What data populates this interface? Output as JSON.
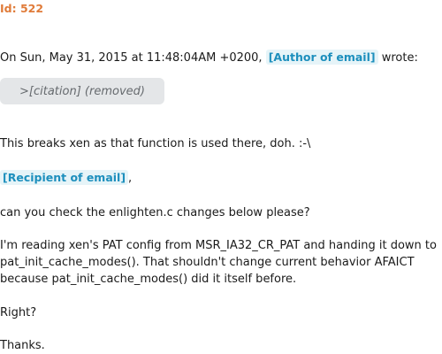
{
  "header": {
    "id_label": "Id: 522"
  },
  "email": {
    "attribution_prefix": "On Sun, May 31, 2015 at 11:48:04AM +0200, ",
    "author_tag": "[Author of email]",
    "attribution_suffix": " wrote:",
    "citation": ">[citation] (removed)",
    "line1": "This breaks xen as that function is used there, doh. :-\\",
    "recipient_tag": "[Recipient of email]",
    "recipient_suffix": ",",
    "line2": "can you check the enlighten.c changes below please?",
    "para1": "I'm reading xen's PAT config from MSR_IA32_CR_PAT and handing it down to",
    "para2": "pat_init_cache_modes(). That shouldn't change current behavior AFAICT",
    "para3": "because pat_init_cache_modes() did it itself before.",
    "line3": "Right?",
    "line4": "Thanks."
  }
}
